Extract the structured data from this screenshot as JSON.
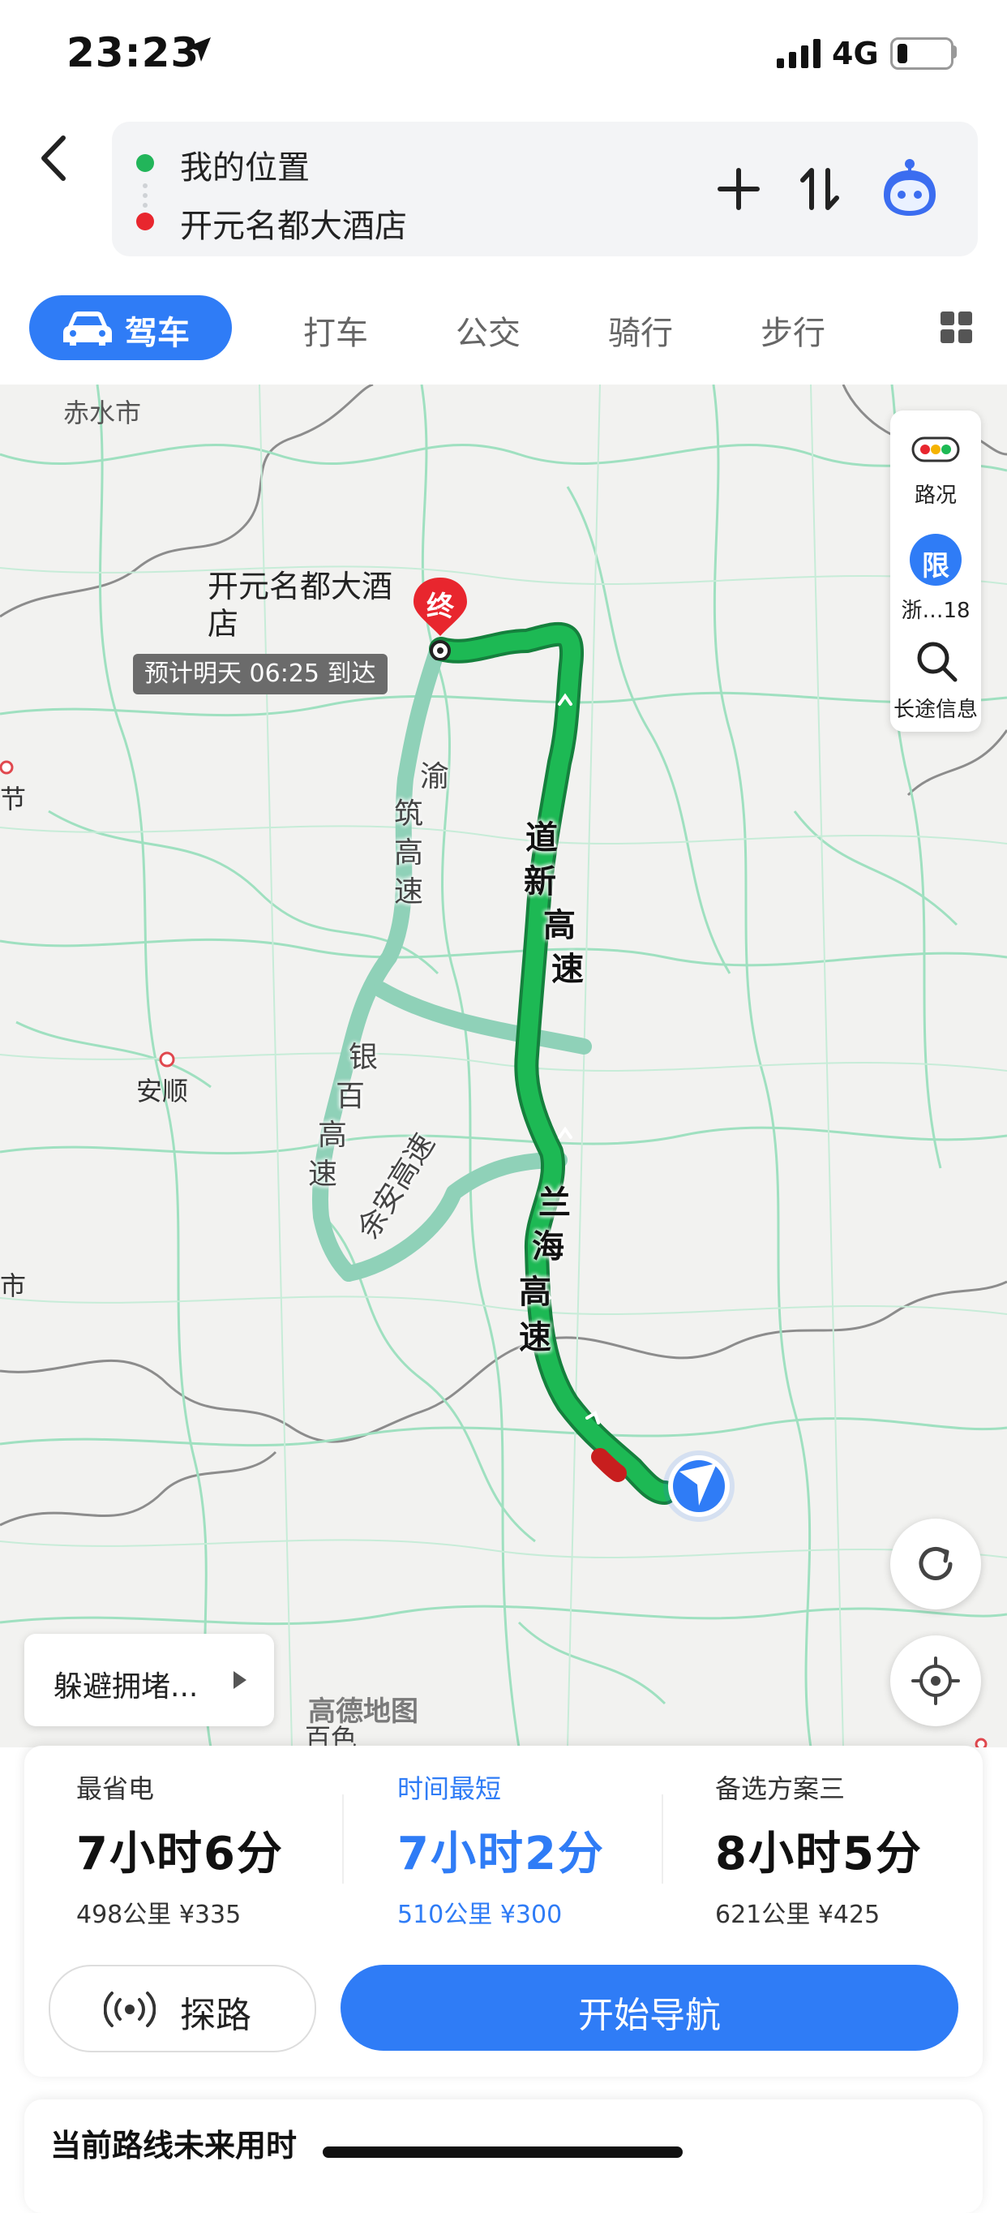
{
  "status_bar": {
    "time": "23:23",
    "network": "4G"
  },
  "header": {
    "from": "我的位置",
    "to": "开元名都大酒店",
    "icons": [
      "back-icon",
      "plus-icon",
      "swap-icon",
      "assistant-icon"
    ]
  },
  "modes": {
    "active": "驾车",
    "tabs": [
      "打车",
      "公交",
      "骑行",
      "步行"
    ]
  },
  "map": {
    "destination_name": "开元名都大酒店",
    "destination_marker": "终",
    "eta": "预计明天 06:25 到达",
    "places": {
      "chishui": "赤水市",
      "anshun": "安顺",
      "bijie": "节",
      "shi": "市",
      "baise": "百色"
    },
    "roads": {
      "main_1": [
        "道",
        "新",
        "高",
        "速"
      ],
      "main_2": [
        "兰",
        "海",
        "高",
        "速"
      ],
      "alt_1": [
        "渝",
        "筑",
        "高",
        "速"
      ],
      "alt_2": [
        "银",
        "百",
        "高",
        "速"
      ],
      "alt_3": "余安高速"
    },
    "watermark": "高德地图",
    "side_panel": {
      "traffic": "路况",
      "limit_badge": "限",
      "limit_label": "浙…18",
      "long_trip": "长途信息"
    },
    "avoid_button": "躲避拥堵...",
    "colors": {
      "route_main": "#1db954",
      "route_alt": "#8fd1b8",
      "accent": "#2f7cf6"
    }
  },
  "route_options": [
    {
      "tag": "最省电",
      "time": "7小时6分",
      "distance": "498公里",
      "cost": "¥335",
      "selected": false
    },
    {
      "tag": "时间最短",
      "time": "7小时2分",
      "distance": "510公里",
      "cost": "¥300",
      "selected": true
    },
    {
      "tag": "备选方案三",
      "time": "8小时5分",
      "distance": "621公里",
      "cost": "¥425",
      "selected": false
    }
  ],
  "actions": {
    "explore": "探路",
    "start_nav": "开始导航"
  },
  "future": {
    "label": "当前路线未来用时"
  }
}
